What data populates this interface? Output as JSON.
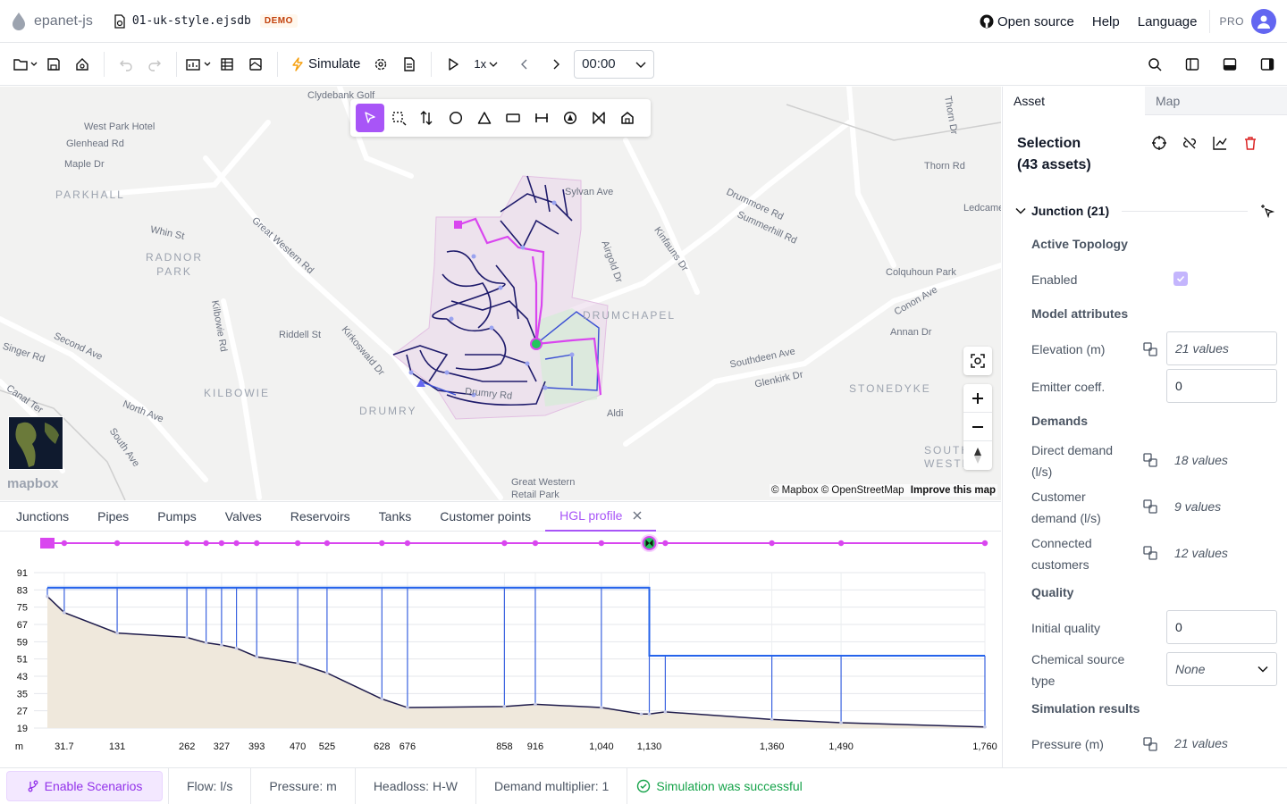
{
  "app": {
    "name": "epanet-js",
    "file_name": "01-uk-style.ejsdb",
    "badge": "DEMO"
  },
  "topnav": {
    "open_source": "Open source",
    "help": "Help",
    "language": "Language",
    "plan": "PRO"
  },
  "toolbar": {
    "simulate": "Simulate",
    "speed": "1x",
    "time": "00:00"
  },
  "map": {
    "labels": [
      {
        "text": "Clydebank Golf",
        "name": "clydebank"
      },
      {
        "text": "West Park Hotel",
        "name": "west-park-hotel"
      },
      {
        "text": "Glenhead Rd",
        "name": "glenhead"
      },
      {
        "text": "Maple Dr",
        "name": "maple"
      },
      {
        "text": "Whin St",
        "name": "whin"
      },
      {
        "text": "Great Western Rd",
        "name": "gwr"
      },
      {
        "text": "Kilbowie Rd",
        "name": "kilbowie-rd"
      },
      {
        "text": "Riddell St",
        "name": "riddell"
      },
      {
        "text": "Kirkoswald Dr",
        "name": "kirkoswald"
      },
      {
        "text": "Singer Rd",
        "name": "singer"
      },
      {
        "text": "Second Ave",
        "name": "second"
      },
      {
        "text": "North Ave",
        "name": "north"
      },
      {
        "text": "South Ave",
        "name": "south"
      },
      {
        "text": "Canal Ter",
        "name": "canal"
      },
      {
        "text": "Sylvan Ave",
        "name": "sylvan"
      },
      {
        "text": "Airgold Dr",
        "name": "airgold"
      },
      {
        "text": "Kinfauns Dr",
        "name": "kinfauns"
      },
      {
        "text": "Drummore Rd",
        "name": "drummore"
      },
      {
        "text": "Summerhill Rd",
        "name": "summerhill"
      },
      {
        "text": "Thorn Rd",
        "name": "thorn-rd"
      },
      {
        "text": "Thorn Dr",
        "name": "thorn-dr"
      },
      {
        "text": "Ledcame",
        "name": "ledcame"
      },
      {
        "text": "Colquhoun Park",
        "name": "colquhoun"
      },
      {
        "text": "Conon Ave",
        "name": "conon"
      },
      {
        "text": "Annan Dr",
        "name": "annan"
      },
      {
        "text": "Southdeen Ave",
        "name": "southdeen"
      },
      {
        "text": "Glenkirk Dr",
        "name": "glenkirk"
      },
      {
        "text": "Drumry Rd",
        "name": "drumry-rd"
      },
      {
        "text": "Aldi",
        "name": "aldi"
      },
      {
        "text": "Great Western Retail Park",
        "name": "retail-park"
      }
    ],
    "areas": [
      {
        "text": "PARKHALL",
        "name": "parkhall"
      },
      {
        "text": "RADNOR PARK",
        "name": "radnor"
      },
      {
        "text": "KILBOWIE",
        "name": "kilbowie"
      },
      {
        "text": "DRUMRY",
        "name": "drumry"
      },
      {
        "text": "DRUMCHAPEL",
        "name": "drumchapel"
      },
      {
        "text": "STONEDYKE",
        "name": "stonedyke"
      },
      {
        "text": "SOUTH WESTER",
        "name": "south-wester"
      }
    ],
    "mapbox": "mapbox",
    "attribution": "© Mapbox © OpenStreetMap",
    "improve": "Improve this map"
  },
  "bottom_tabs": [
    "Junctions",
    "Pipes",
    "Pumps",
    "Valves",
    "Reservoirs",
    "Tanks",
    "Customer points",
    "HGL profile"
  ],
  "chart_data": {
    "type": "line",
    "title": "",
    "xlabel": "",
    "ylabel": "m",
    "xlim": [
      0,
      1760
    ],
    "ylim": [
      19,
      91
    ],
    "y_ticks": [
      91,
      83,
      75,
      67,
      59,
      51,
      43,
      35,
      27,
      19
    ],
    "x_ticks": [
      31.7,
      131,
      262,
      327,
      393,
      470,
      525,
      628,
      676,
      858,
      916,
      1040,
      1130,
      1360,
      1490,
      1760
    ],
    "x_tick_labels": [
      "31.7",
      "131",
      "262",
      "327",
      "393",
      "470",
      "525",
      "628",
      "676",
      "858",
      "916",
      "1,040",
      "1,130",
      "1,360",
      "1,490",
      "1,760"
    ],
    "series": [
      {
        "name": "",
        "color": "#1e1b4b",
        "x": [
          0,
          31.7,
          131,
          262,
          298,
          327,
          355,
          393,
          470,
          525,
          628,
          676,
          858,
          916,
          1040,
          1115,
          1130,
          1160,
          1360,
          1490,
          1760
        ],
        "values": [
          80,
          72.5,
          63,
          61,
          58.5,
          57.5,
          56,
          52,
          49,
          44.5,
          32.5,
          28.5,
          29,
          30,
          28.5,
          25.5,
          25.5,
          26.5,
          23,
          21.5,
          19.5
        ]
      },
      {
        "name": "",
        "color": "#2563eb",
        "x": [
          0,
          1130,
          1130,
          1760
        ],
        "values": [
          84,
          84,
          52.5,
          52.5
        ]
      }
    ],
    "nodes_x": [
      0,
      31.7,
      131,
      262,
      298,
      327,
      355,
      393,
      470,
      525,
      628,
      676,
      858,
      916,
      1040,
      1130,
      1160,
      1360,
      1490,
      1760
    ]
  },
  "panel": {
    "tabs": [
      "Asset",
      "Map"
    ],
    "selection_title": "Selection",
    "selection_count": "(43 assets)",
    "group": "Junction (21)",
    "sections": {
      "topology": "Active Topology",
      "model": "Model attributes",
      "demands": "Demands",
      "quality": "Quality",
      "results": "Simulation results"
    },
    "props": {
      "enabled": "Enabled",
      "elevation": {
        "label": "Elevation (m)",
        "value": "21 values"
      },
      "emitter": {
        "label": "Emitter coeff.",
        "value": "0"
      },
      "direct_demand": {
        "label": "Direct demand (l/s)",
        "value": "18 values"
      },
      "customer_demand": {
        "label": "Customer demand (l/s)",
        "value": "9 values"
      },
      "connected": {
        "label": "Connected customers",
        "value": "12 values"
      },
      "initial_quality": {
        "label": "Initial quality",
        "value": "0"
      },
      "chem_source": {
        "label": "Chemical source type",
        "value": "None"
      },
      "pressure": {
        "label": "Pressure (m)",
        "value": "21 values"
      }
    }
  },
  "status": {
    "scenarios": "Enable Scenarios",
    "flow": "Flow: l/s",
    "pressure": "Pressure: m",
    "headloss": "Headloss: H-W",
    "demand_mult": "Demand multiplier: 1",
    "sim": "Simulation was successful"
  },
  "colors": {
    "accent": "#a855f7",
    "hgl": "#2563eb",
    "elevation_fill": "#efe8dc",
    "success": "#16a34a"
  }
}
